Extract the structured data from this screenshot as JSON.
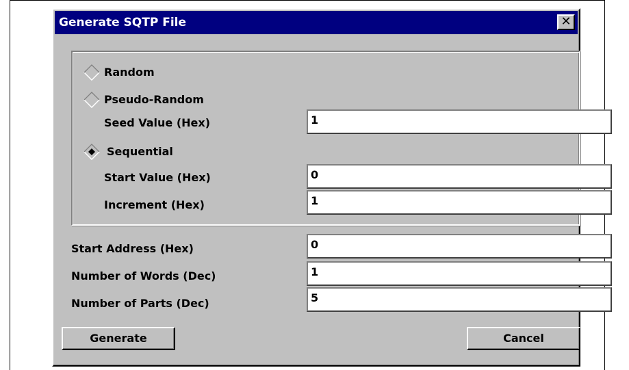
{
  "dialog": {
    "title": "Generate SQTP File",
    "close_glyph": "✕",
    "close_icon": "close-icon"
  },
  "mode": {
    "selected": "sequential",
    "options": {
      "random": {
        "label": "Random",
        "checked": false
      },
      "pseudo_random": {
        "label": "Pseudo-Random",
        "checked": false
      },
      "sequential": {
        "label": "Sequential",
        "checked": true
      }
    }
  },
  "fields": {
    "seed_value": {
      "label": "Seed Value (Hex)",
      "value": "1"
    },
    "start_value": {
      "label": "Start Value (Hex)",
      "value": "0"
    },
    "increment": {
      "label": "Increment (Hex)",
      "value": "1"
    },
    "start_address": {
      "label": "Start Address (Hex)",
      "value": "0"
    },
    "number_of_words": {
      "label": "Number of Words (Dec)",
      "value": "1"
    },
    "number_of_parts": {
      "label": "Number of Parts (Dec)",
      "value": "5"
    }
  },
  "buttons": {
    "generate": "Generate",
    "cancel": "Cancel"
  },
  "colors": {
    "titlebar": "#000080",
    "face": "#c0c0c0"
  }
}
